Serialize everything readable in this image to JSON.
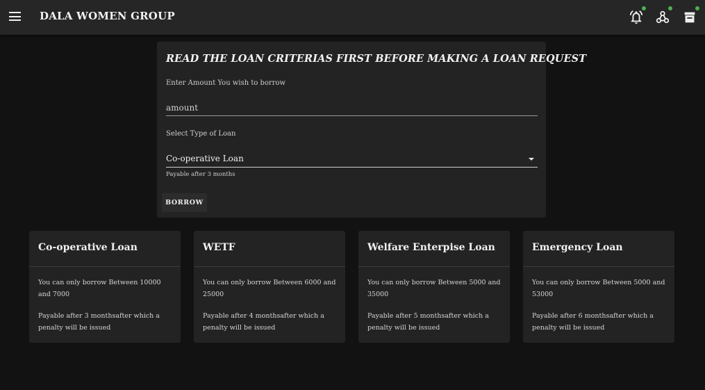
{
  "appbar": {
    "title": "DALA WOMEN GROUP",
    "icons": [
      "menu-icon",
      "notification-bell-icon",
      "share-nodes-icon",
      "inbox-icon"
    ],
    "badge_color": "#4caf50"
  },
  "loan_form": {
    "heading": "READ THE LOAN CRITERIAS FIRST BEFORE MAKING A LOAN REQUEST",
    "amount_label": "Enter Amount You wish to borrow",
    "amount_placeholder": "amount",
    "type_label": "Select Type of Loan",
    "selected_type": "Co-operative Loan",
    "helper_text": "Payable after 3 months",
    "borrow_label": "BORROW"
  },
  "loan_cards": [
    {
      "title": "Co-operative Loan",
      "range_text": "You can only borrow Between 10000 and 7000",
      "penalty_text": "Payable after 3 monthsafter which a penalty will be issued"
    },
    {
      "title": "WETF",
      "range_text": "You can only borrow Between 6000 and 25000",
      "penalty_text": "Payable after 4 monthsafter which a penalty will be issued"
    },
    {
      "title": "Welfare Enterpise Loan",
      "range_text": "You can only borrow Between 5000 and 35000",
      "penalty_text": "Payable after 5 monthsafter which a penalty will be issued"
    },
    {
      "title": "Emergency Loan",
      "range_text": "You can only borrow Between 5000 and 53000",
      "penalty_text": "Payable after 6 monthsafter which a penalty will be issued"
    }
  ]
}
